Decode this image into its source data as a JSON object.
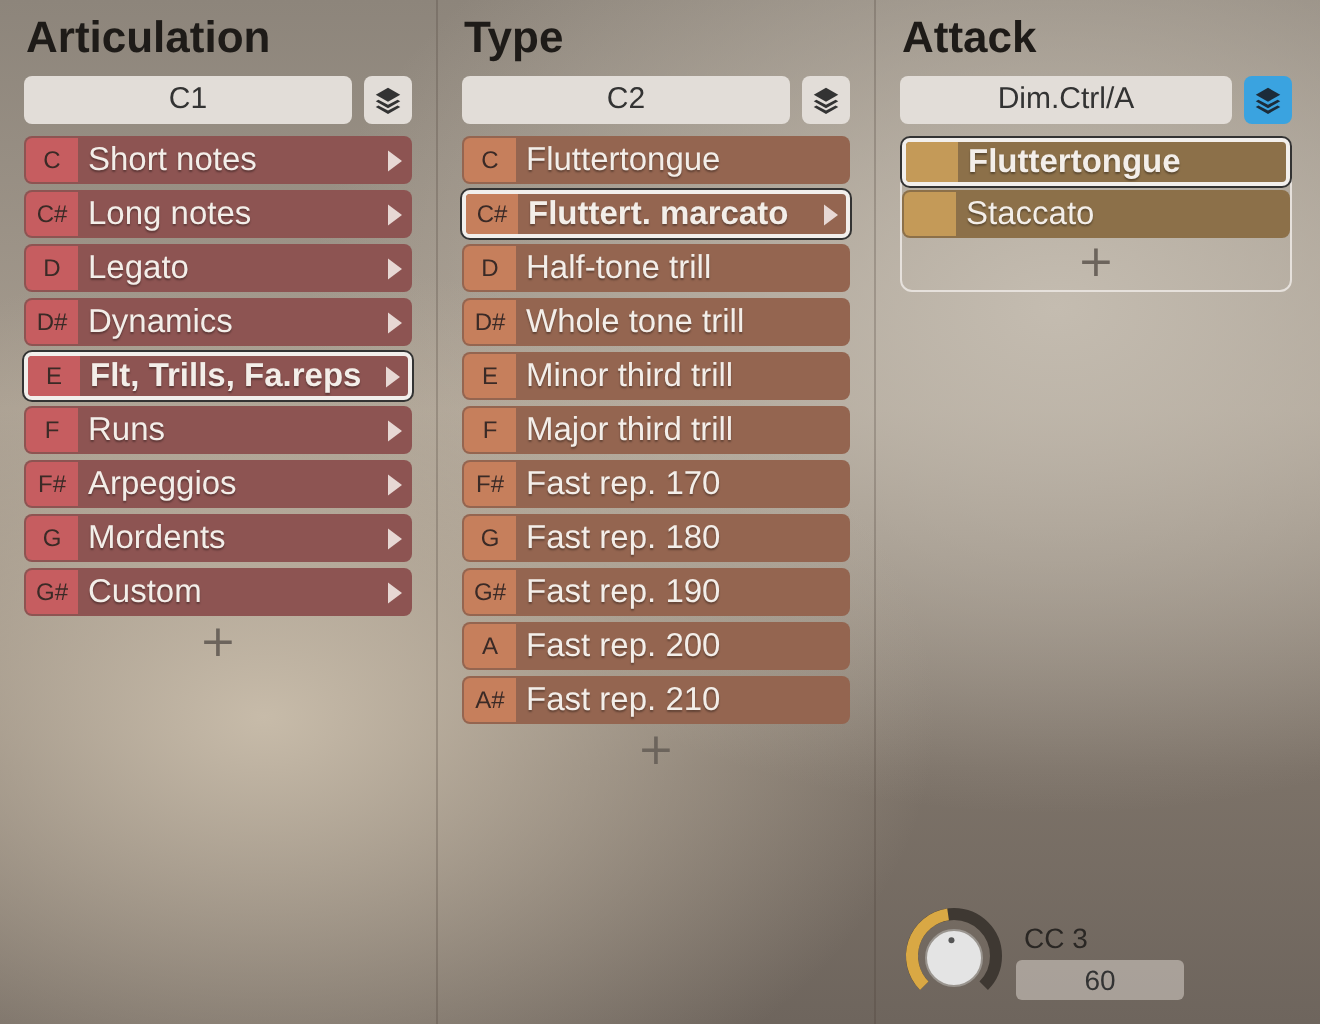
{
  "columns": [
    {
      "title": "Articulation",
      "kind": "articulation",
      "selector": "C1",
      "layers_active": false,
      "framed": false,
      "add_button": "+",
      "items": [
        {
          "key": "C",
          "label": "Short notes",
          "submenu": true,
          "selected": false
        },
        {
          "key": "C#",
          "label": "Long notes",
          "submenu": true,
          "selected": false
        },
        {
          "key": "D",
          "label": "Legato",
          "submenu": true,
          "selected": false
        },
        {
          "key": "D#",
          "label": "Dynamics",
          "submenu": true,
          "selected": false
        },
        {
          "key": "E",
          "label": "Flt, Trills, Fa.reps",
          "submenu": true,
          "selected": true
        },
        {
          "key": "F",
          "label": "Runs",
          "submenu": true,
          "selected": false
        },
        {
          "key": "F#",
          "label": "Arpeggios",
          "submenu": true,
          "selected": false
        },
        {
          "key": "G",
          "label": "Mordents",
          "submenu": true,
          "selected": false
        },
        {
          "key": "G#",
          "label": "Custom",
          "submenu": true,
          "selected": false
        }
      ]
    },
    {
      "title": "Type",
      "kind": "type",
      "selector": "C2",
      "layers_active": false,
      "framed": false,
      "add_button": "+",
      "items": [
        {
          "key": "C",
          "label": "Fluttertongue",
          "submenu": false,
          "selected": false
        },
        {
          "key": "C#",
          "label": "Fluttert. marcato",
          "submenu": true,
          "selected": true
        },
        {
          "key": "D",
          "label": "Half-tone trill",
          "submenu": false,
          "selected": false
        },
        {
          "key": "D#",
          "label": "Whole tone trill",
          "submenu": false,
          "selected": false
        },
        {
          "key": "E",
          "label": "Minor third trill",
          "submenu": false,
          "selected": false
        },
        {
          "key": "F",
          "label": "Major third trill",
          "submenu": false,
          "selected": false
        },
        {
          "key": "F#",
          "label": "Fast rep. 170",
          "submenu": false,
          "selected": false
        },
        {
          "key": "G",
          "label": "Fast rep. 180",
          "submenu": false,
          "selected": false
        },
        {
          "key": "G#",
          "label": "Fast rep. 190",
          "submenu": false,
          "selected": false
        },
        {
          "key": "A",
          "label": "Fast rep. 200",
          "submenu": false,
          "selected": false
        },
        {
          "key": "A#",
          "label": "Fast rep. 210",
          "submenu": false,
          "selected": false
        }
      ]
    },
    {
      "title": "Attack",
      "kind": "attack",
      "selector": "Dim.Ctrl/A",
      "layers_active": true,
      "framed": true,
      "add_button": "+",
      "items": [
        {
          "label": "Fluttertongue",
          "submenu": false,
          "selected": true
        },
        {
          "label": "Staccato",
          "submenu": false,
          "selected": false
        }
      ],
      "knob": {
        "label": "CC 3",
        "value": "60"
      }
    }
  ]
}
